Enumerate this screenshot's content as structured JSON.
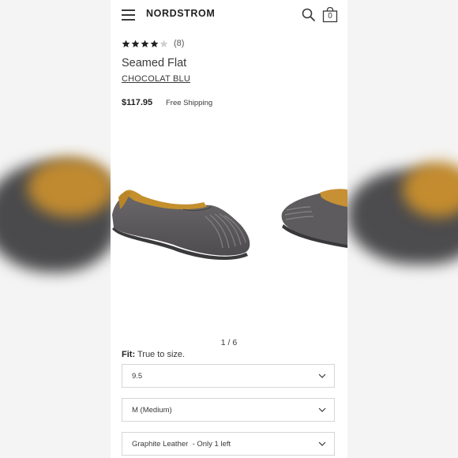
{
  "header": {
    "brand": "NORDSTROM",
    "bag_count": "0"
  },
  "product": {
    "rating": 4,
    "rating_max": 5,
    "review_count": "(8)",
    "title": "Seamed Flat",
    "color_name": "CHOCOLAT BLU",
    "price": "$117.95",
    "shipping": "Free Shipping"
  },
  "gallery": {
    "pager": "1 / 6"
  },
  "fit": {
    "label": "Fit:",
    "value": "True to size."
  },
  "selects": {
    "size": "9.5",
    "width": "M (Medium)",
    "color": "Graphite Leather  - Only 1 left"
  },
  "colors": {
    "text": "#393939",
    "border": "#d6d6d6",
    "shoe_gray": "#5e5c5d",
    "shoe_lining": "#c4902e"
  }
}
